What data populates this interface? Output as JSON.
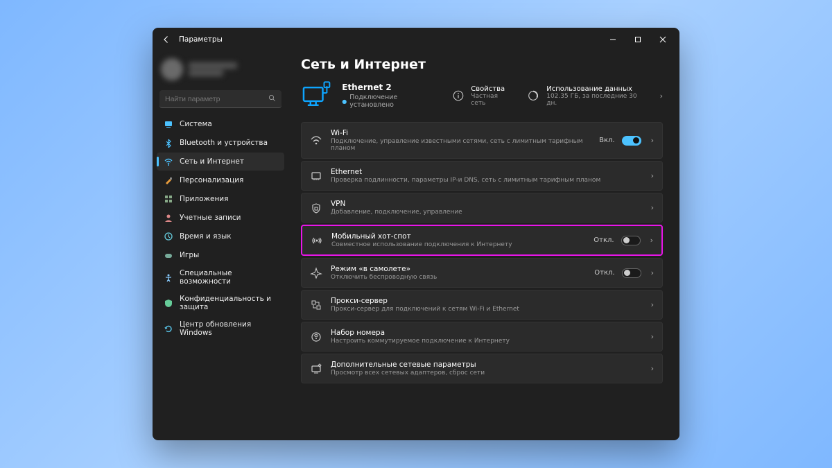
{
  "titlebar": {
    "title": "Параметры"
  },
  "search": {
    "placeholder": "Найти параметр"
  },
  "nav": [
    {
      "label": "Система",
      "icon": "system"
    },
    {
      "label": "Bluetooth и устройства",
      "icon": "bluetooth"
    },
    {
      "label": "Сеть и Интернет",
      "icon": "wifi",
      "active": true
    },
    {
      "label": "Персонализация",
      "icon": "brush"
    },
    {
      "label": "Приложения",
      "icon": "apps"
    },
    {
      "label": "Учетные записи",
      "icon": "account"
    },
    {
      "label": "Время и язык",
      "icon": "time"
    },
    {
      "label": "Игры",
      "icon": "games"
    },
    {
      "label": "Специальные возможности",
      "icon": "access"
    },
    {
      "label": "Конфиденциальность и защита",
      "icon": "privacy"
    },
    {
      "label": "Центр обновления Windows",
      "icon": "update"
    }
  ],
  "page": {
    "title": "Сеть и Интернет"
  },
  "hero": {
    "title": "Ethernet 2",
    "subtitle": "Подключение установлено",
    "info1": {
      "title": "Свойства",
      "sub": "Частная сеть"
    },
    "info2": {
      "title": "Использование данных",
      "sub": "102.35 ГБ, за последние 30 дн."
    }
  },
  "cards": [
    {
      "icon": "wifi",
      "title": "Wi-Fi",
      "sub": "Подключение, управление известными сетями, сеть с лимитным тарифным планом",
      "toggle": "on",
      "toggle_label": "Вкл."
    },
    {
      "icon": "ethernet",
      "title": "Ethernet",
      "sub": "Проверка подлинности, параметры IP-и DNS, сеть с лимитным тарифным планом"
    },
    {
      "icon": "vpn",
      "title": "VPN",
      "sub": "Добавление, подключение, управление"
    },
    {
      "icon": "hotspot",
      "title": "Мобильный хот-спот",
      "sub": "Совместное использование подключения к Интернету",
      "toggle": "off",
      "toggle_label": "Откл.",
      "highlight": true
    },
    {
      "icon": "airplane",
      "title": "Режим «в самолете»",
      "sub": "Отключить беспроводную связь",
      "toggle": "off",
      "toggle_label": "Откл."
    },
    {
      "icon": "proxy",
      "title": "Прокси-сервер",
      "sub": "Прокси-сервер для подключений к сетям Wi-Fi и Ethernet"
    },
    {
      "icon": "dialup",
      "title": "Набор номера",
      "sub": "Настроить коммутируемое подключение к Интернету"
    },
    {
      "icon": "advanced",
      "title": "Дополнительные сетевые параметры",
      "sub": "Просмотр всех сетевых адаптеров, сброс сети"
    }
  ]
}
